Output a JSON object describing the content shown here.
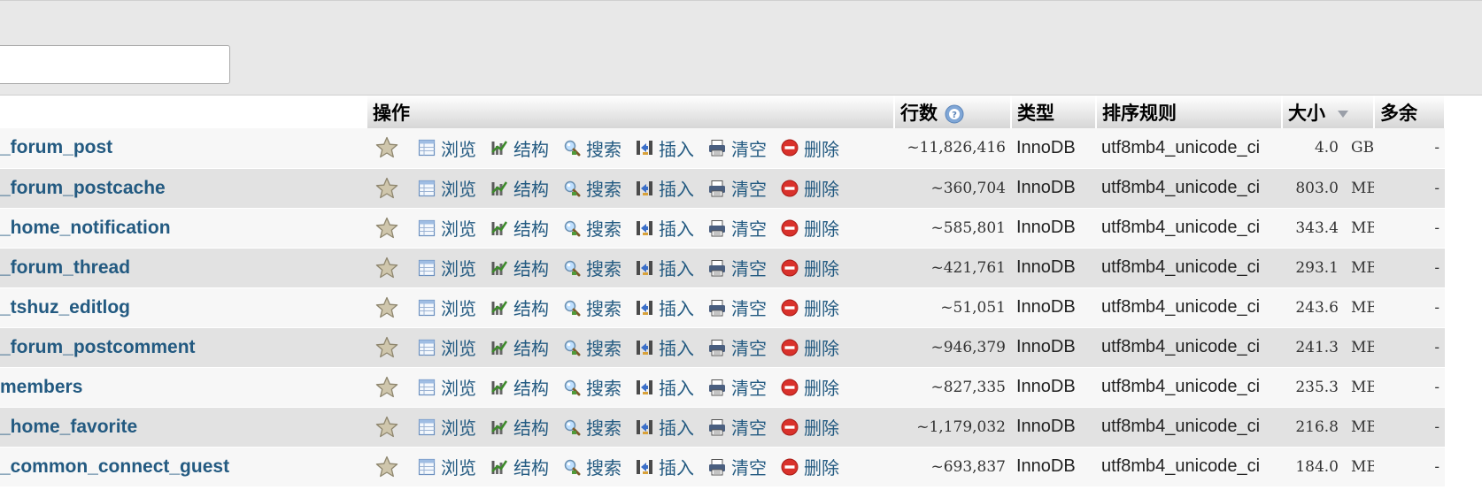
{
  "header": {
    "actions": "操作",
    "rows": "行数",
    "type": "类型",
    "collation": "排序规则",
    "size": "大小",
    "overhead": "多余"
  },
  "actions": {
    "browse": "浏览",
    "structure": "结构",
    "search": "搜索",
    "insert": "插入",
    "empty": "清空",
    "drop": "删除"
  },
  "tables": [
    {
      "name": "_forum_post",
      "rows": "~11,826,416",
      "type": "InnoDB",
      "collation": "utf8mb4_unicode_ci",
      "size": "4.0",
      "unit": "GB",
      "overhead": "-"
    },
    {
      "name": "_forum_postcache",
      "rows": "~360,704",
      "type": "InnoDB",
      "collation": "utf8mb4_unicode_ci",
      "size": "803.0",
      "unit": "MB",
      "overhead": "-"
    },
    {
      "name": "_home_notification",
      "rows": "~585,801",
      "type": "InnoDB",
      "collation": "utf8mb4_unicode_ci",
      "size": "343.4",
      "unit": "MB",
      "overhead": "-"
    },
    {
      "name": "_forum_thread",
      "rows": "~421,761",
      "type": "InnoDB",
      "collation": "utf8mb4_unicode_ci",
      "size": "293.1",
      "unit": "MB",
      "overhead": "-"
    },
    {
      "name": "_tshuz_editlog",
      "rows": "~51,051",
      "type": "InnoDB",
      "collation": "utf8mb4_unicode_ci",
      "size": "243.6",
      "unit": "MB",
      "overhead": "-"
    },
    {
      "name": "_forum_postcomment",
      "rows": "~946,379",
      "type": "InnoDB",
      "collation": "utf8mb4_unicode_ci",
      "size": "241.3",
      "unit": "MB",
      "overhead": "-"
    },
    {
      "name": "members",
      "rows": "~827,335",
      "type": "InnoDB",
      "collation": "utf8mb4_unicode_ci",
      "size": "235.3",
      "unit": "MB",
      "overhead": "-"
    },
    {
      "name": "_home_favorite",
      "rows": "~1,179,032",
      "type": "InnoDB",
      "collation": "utf8mb4_unicode_ci",
      "size": "216.8",
      "unit": "MB",
      "overhead": "-"
    },
    {
      "name": "_common_connect_guest",
      "rows": "~693,837",
      "type": "InnoDB",
      "collation": "utf8mb4_unicode_ci",
      "size": "184.0",
      "unit": "MB",
      "overhead": "-"
    }
  ]
}
